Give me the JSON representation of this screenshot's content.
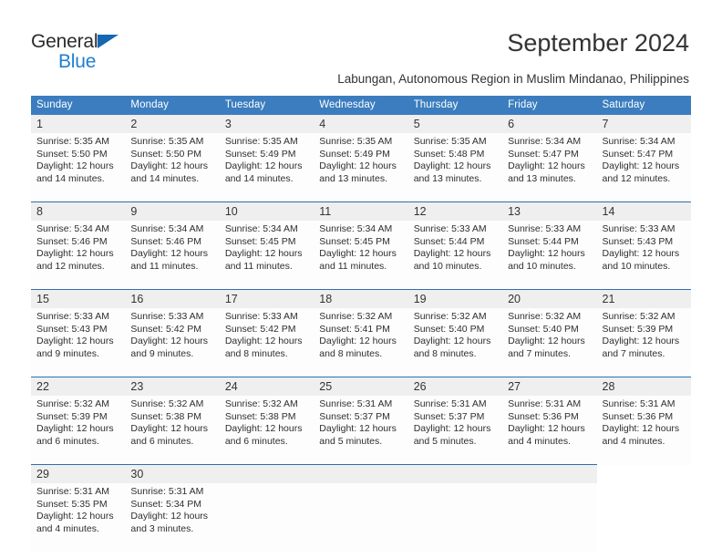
{
  "brand": {
    "name_part1": "General",
    "name_part2": "Blue",
    "triangle_color": "#1667b2",
    "blue_color": "#1f7fd0"
  },
  "header": {
    "title": "September 2024",
    "subtitle": "Labungan, Autonomous Region in Muslim Mindanao, Philippines",
    "accent_color": "#3b7dbf",
    "date_band_color": "#efefef"
  },
  "weekday_headers": [
    "Sunday",
    "Monday",
    "Tuesday",
    "Wednesday",
    "Thursday",
    "Friday",
    "Saturday"
  ],
  "weeks": [
    {
      "dates": [
        "1",
        "2",
        "3",
        "4",
        "5",
        "6",
        "7"
      ],
      "info": [
        "Sunrise: 5:35 AM\nSunset: 5:50 PM\nDaylight: 12 hours and 14 minutes.",
        "Sunrise: 5:35 AM\nSunset: 5:50 PM\nDaylight: 12 hours and 14 minutes.",
        "Sunrise: 5:35 AM\nSunset: 5:49 PM\nDaylight: 12 hours and 14 minutes.",
        "Sunrise: 5:35 AM\nSunset: 5:49 PM\nDaylight: 12 hours and 13 minutes.",
        "Sunrise: 5:35 AM\nSunset: 5:48 PM\nDaylight: 12 hours and 13 minutes.",
        "Sunrise: 5:34 AM\nSunset: 5:47 PM\nDaylight: 12 hours and 13 minutes.",
        "Sunrise: 5:34 AM\nSunset: 5:47 PM\nDaylight: 12 hours and 12 minutes."
      ]
    },
    {
      "dates": [
        "8",
        "9",
        "10",
        "11",
        "12",
        "13",
        "14"
      ],
      "info": [
        "Sunrise: 5:34 AM\nSunset: 5:46 PM\nDaylight: 12 hours and 12 minutes.",
        "Sunrise: 5:34 AM\nSunset: 5:46 PM\nDaylight: 12 hours and 11 minutes.",
        "Sunrise: 5:34 AM\nSunset: 5:45 PM\nDaylight: 12 hours and 11 minutes.",
        "Sunrise: 5:34 AM\nSunset: 5:45 PM\nDaylight: 12 hours and 11 minutes.",
        "Sunrise: 5:33 AM\nSunset: 5:44 PM\nDaylight: 12 hours and 10 minutes.",
        "Sunrise: 5:33 AM\nSunset: 5:44 PM\nDaylight: 12 hours and 10 minutes.",
        "Sunrise: 5:33 AM\nSunset: 5:43 PM\nDaylight: 12 hours and 10 minutes."
      ]
    },
    {
      "dates": [
        "15",
        "16",
        "17",
        "18",
        "19",
        "20",
        "21"
      ],
      "info": [
        "Sunrise: 5:33 AM\nSunset: 5:43 PM\nDaylight: 12 hours and 9 minutes.",
        "Sunrise: 5:33 AM\nSunset: 5:42 PM\nDaylight: 12 hours and 9 minutes.",
        "Sunrise: 5:33 AM\nSunset: 5:42 PM\nDaylight: 12 hours and 8 minutes.",
        "Sunrise: 5:32 AM\nSunset: 5:41 PM\nDaylight: 12 hours and 8 minutes.",
        "Sunrise: 5:32 AM\nSunset: 5:40 PM\nDaylight: 12 hours and 8 minutes.",
        "Sunrise: 5:32 AM\nSunset: 5:40 PM\nDaylight: 12 hours and 7 minutes.",
        "Sunrise: 5:32 AM\nSunset: 5:39 PM\nDaylight: 12 hours and 7 minutes."
      ]
    },
    {
      "dates": [
        "22",
        "23",
        "24",
        "25",
        "26",
        "27",
        "28"
      ],
      "info": [
        "Sunrise: 5:32 AM\nSunset: 5:39 PM\nDaylight: 12 hours and 6 minutes.",
        "Sunrise: 5:32 AM\nSunset: 5:38 PM\nDaylight: 12 hours and 6 minutes.",
        "Sunrise: 5:32 AM\nSunset: 5:38 PM\nDaylight: 12 hours and 6 minutes.",
        "Sunrise: 5:31 AM\nSunset: 5:37 PM\nDaylight: 12 hours and 5 minutes.",
        "Sunrise: 5:31 AM\nSunset: 5:37 PM\nDaylight: 12 hours and 5 minutes.",
        "Sunrise: 5:31 AM\nSunset: 5:36 PM\nDaylight: 12 hours and 4 minutes.",
        "Sunrise: 5:31 AM\nSunset: 5:36 PM\nDaylight: 12 hours and 4 minutes."
      ]
    },
    {
      "dates": [
        "29",
        "30",
        "",
        "",
        "",
        "",
        ""
      ],
      "info": [
        "Sunrise: 5:31 AM\nSunset: 5:35 PM\nDaylight: 12 hours and 4 minutes.",
        "Sunrise: 5:31 AM\nSunset: 5:34 PM\nDaylight: 12 hours and 3 minutes.",
        "",
        "",
        "",
        "",
        ""
      ]
    }
  ]
}
